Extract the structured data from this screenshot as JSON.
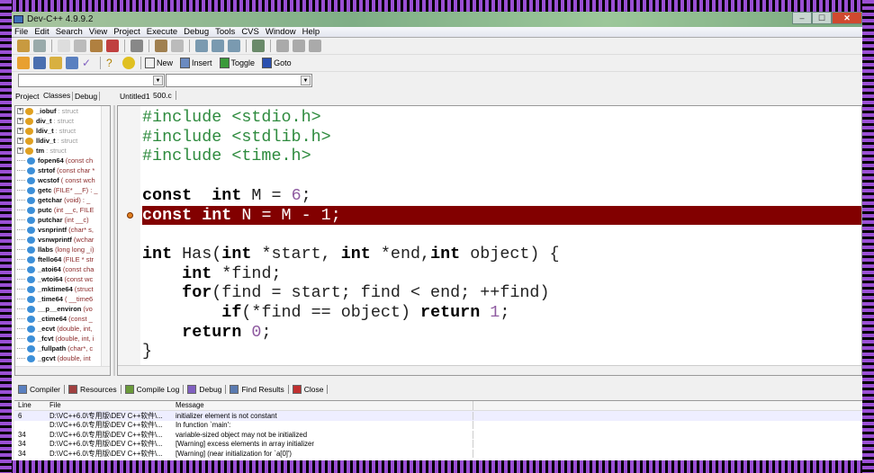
{
  "window": {
    "title": "Dev-C++ 4.9.9.2",
    "min": "–",
    "max": "☐",
    "close": "✕"
  },
  "menu": [
    "File",
    "Edit",
    "Search",
    "View",
    "Project",
    "Execute",
    "Debug",
    "Tools",
    "CVS",
    "Window",
    "Help"
  ],
  "toolbar2": {
    "new": "New",
    "insert": "Insert",
    "toggle": "Toggle",
    "goto": "Goto"
  },
  "left_tabs": [
    "Project",
    "Classes",
    "Debug"
  ],
  "editor_tabs": [
    "Untitled1",
    "500.c"
  ],
  "tree": [
    {
      "name": "_iobuf",
      "sig": ": struct",
      "type": "struct"
    },
    {
      "name": "div_t",
      "sig": ": struct",
      "type": "struct"
    },
    {
      "name": "ldiv_t",
      "sig": ": struct",
      "type": "struct"
    },
    {
      "name": "lldiv_t",
      "sig": ": struct",
      "type": "struct"
    },
    {
      "name": "tm",
      "sig": ": struct",
      "type": "struct"
    },
    {
      "name": "fopen64",
      "sig": "(const ch",
      "type": "func"
    },
    {
      "name": "strtof",
      "sig": "(const char *",
      "type": "func"
    },
    {
      "name": "wcstof",
      "sig": "( const wch",
      "type": "func"
    },
    {
      "name": "getc",
      "sig": "(FILE* __F) : _",
      "type": "func"
    },
    {
      "name": "getchar",
      "sig": "(void) : _",
      "type": "func"
    },
    {
      "name": "putc",
      "sig": "(int __c, FILE",
      "type": "func"
    },
    {
      "name": "putchar",
      "sig": "(int __c)",
      "type": "func"
    },
    {
      "name": "vsnprintf",
      "sig": "(char* s,",
      "type": "func"
    },
    {
      "name": "vsnwprintf",
      "sig": "(wchar",
      "type": "func"
    },
    {
      "name": "llabs",
      "sig": "(long long _i)",
      "type": "func"
    },
    {
      "name": "ftello64",
      "sig": "(FILE * str",
      "type": "func"
    },
    {
      "name": "_atoi64",
      "sig": "(const cha",
      "type": "func"
    },
    {
      "name": "_wtoi64",
      "sig": "(const wc",
      "type": "func"
    },
    {
      "name": "_mktime64",
      "sig": "(struct",
      "type": "func"
    },
    {
      "name": "_time64",
      "sig": "( __time6",
      "type": "func"
    },
    {
      "name": "__p__environ",
      "sig": "(vo",
      "type": "func"
    },
    {
      "name": "_ctime64",
      "sig": "(const _",
      "type": "func"
    },
    {
      "name": "_ecvt",
      "sig": "(double, int,",
      "type": "func"
    },
    {
      "name": "_fcvt",
      "sig": "(double, int, i",
      "type": "func"
    },
    {
      "name": "_fullpath",
      "sig": "(char*, c",
      "type": "func"
    },
    {
      "name": "_gcvt",
      "sig": "(double, int",
      "type": "func"
    }
  ],
  "code": [
    [
      [
        "pp",
        "#include <stdio.h>"
      ]
    ],
    [
      [
        "pp",
        "#include <stdlib.h>"
      ]
    ],
    [
      [
        "pp",
        "#include <time.h>"
      ]
    ],
    [],
    [
      [
        "kw",
        "const"
      ],
      [
        "",
        "  "
      ],
      [
        "kw",
        "int"
      ],
      [
        "",
        " M = "
      ],
      [
        "num",
        "6"
      ],
      [
        "",
        ";"
      ]
    ],
    [
      [
        "kw",
        "const"
      ],
      [
        "",
        " "
      ],
      [
        "kw",
        "int"
      ],
      [
        "",
        " N = M - "
      ],
      [
        "num",
        "1"
      ],
      [
        "",
        ";"
      ]
    ],
    [],
    [
      [
        "kw",
        "int"
      ],
      [
        "",
        " Has("
      ],
      [
        "kw",
        "int"
      ],
      [
        "",
        " *start, "
      ],
      [
        "kw",
        "int"
      ],
      [
        "",
        " *end,"
      ],
      [
        "kw",
        "int"
      ],
      [
        "",
        " object) {"
      ]
    ],
    [
      [
        "",
        "    "
      ],
      [
        "kw",
        "int"
      ],
      [
        "",
        " *find;"
      ]
    ],
    [
      [
        "",
        "    "
      ],
      [
        "kw",
        "for"
      ],
      [
        "",
        "(find = start; find < end; ++find)"
      ]
    ],
    [
      [
        "",
        "        "
      ],
      [
        "kw",
        "if"
      ],
      [
        "",
        "(*find == object) "
      ],
      [
        "kw",
        "return"
      ],
      [
        "",
        " "
      ],
      [
        "num",
        "1"
      ],
      [
        "",
        ";"
      ]
    ],
    [
      [
        "",
        "    "
      ],
      [
        "kw",
        "return"
      ],
      [
        "",
        " "
      ],
      [
        "num",
        "0"
      ],
      [
        "",
        ";"
      ]
    ],
    [
      [
        "",
        "}"
      ]
    ]
  ],
  "highlighted_line": 5,
  "bottom_tabs": [
    "Compiler",
    "Resources",
    "Compile Log",
    "Debug",
    "Find Results",
    "Close"
  ],
  "grid": {
    "headers": [
      "Line",
      "File",
      "Message"
    ],
    "rows": [
      [
        "6",
        "D:\\VC++6.0\\专用版\\DEV C++软件\\...",
        "initializer element is not constant"
      ],
      [
        "",
        "D:\\VC++6.0\\专用版\\DEV C++软件\\...",
        "In function `main':"
      ],
      [
        "34",
        "D:\\VC++6.0\\专用版\\DEV C++软件\\...",
        "variable-sized object may not be initialized"
      ],
      [
        "34",
        "D:\\VC++6.0\\专用版\\DEV C++软件\\...",
        "[Warning] excess elements in array initializer"
      ],
      [
        "34",
        "D:\\VC++6.0\\专用版\\DEV C++软件\\...",
        "[Warning] (near initialization for `a[0]')"
      ]
    ]
  },
  "colors": {
    "highlight": "#820000",
    "preprocessor": "#2e8b3e",
    "number": "#8e5aa0",
    "frame_stripe": "#9a4fd4"
  }
}
